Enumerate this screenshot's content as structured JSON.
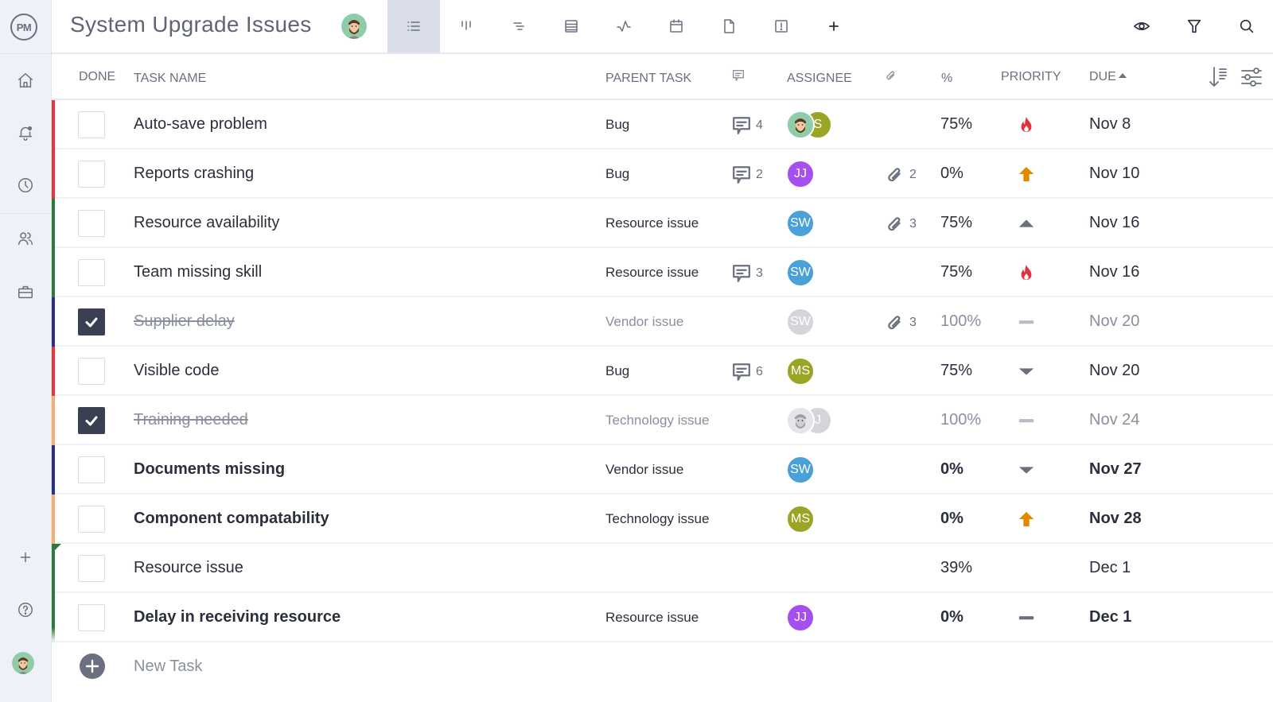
{
  "colors": {
    "red": "#e8343a",
    "green": "#2d7a3a",
    "navy": "#2b2f8f",
    "orange": "#f5b070",
    "jj": "#a64ff0",
    "sw": "#4aa0d9",
    "ms": "#9aa526",
    "grey_avatar": "#d3d5da",
    "priority_critical": "#e03340",
    "priority_high": "#e08a00",
    "priority_neutral": "#6b7080",
    "priority_done": "#b9bcc4"
  },
  "sidebar": {
    "logo": "PM",
    "items": [
      {
        "icon": "home-icon"
      },
      {
        "icon": "notifications-bell-icon"
      },
      {
        "icon": "clock-icon"
      },
      {
        "icon": "team-icon"
      },
      {
        "icon": "briefcase-icon"
      },
      {
        "icon": "plus-icon"
      },
      {
        "icon": "help-icon"
      },
      {
        "icon": "user-avatar"
      }
    ]
  },
  "header": {
    "title": "System Upgrade Issues",
    "view_tabs": [
      {
        "name": "list-view",
        "active": true
      },
      {
        "name": "board-view",
        "active": false
      },
      {
        "name": "gantt-view",
        "active": false
      },
      {
        "name": "sheet-view",
        "active": false
      },
      {
        "name": "dashboard-view",
        "active": false
      },
      {
        "name": "calendar-view",
        "active": false
      },
      {
        "name": "files-view",
        "active": false
      },
      {
        "name": "risks-view",
        "active": false
      },
      {
        "name": "add-view",
        "active": false
      }
    ],
    "actions": [
      "show-hide",
      "filter",
      "search"
    ]
  },
  "table": {
    "columns": {
      "done": "DONE",
      "task_name": "TASK NAME",
      "parent_task": "PARENT TASK",
      "comments": "comments-icon",
      "assignee": "ASSIGNEE",
      "attachments": "attachment-icon",
      "percent": "%",
      "priority": "PRIORITY",
      "due": "DUE"
    },
    "sort": {
      "column": "DUE",
      "direction": "ascending"
    },
    "rows": [
      {
        "name": "Auto-save problem",
        "parent": "Bug",
        "comments": "4",
        "attachments": "",
        "assignees": [
          {
            "type": "photo"
          },
          {
            "initials": "S",
            "color": "ms"
          }
        ],
        "percent": "75%",
        "priority": "critical",
        "due": "Nov 8",
        "done": false,
        "bold": false,
        "bar": "red"
      },
      {
        "name": "Reports crashing",
        "parent": "Bug",
        "comments": "2",
        "attachments": "2",
        "assignees": [
          {
            "initials": "JJ",
            "color": "jj"
          }
        ],
        "percent": "0%",
        "priority": "high",
        "due": "Nov 10",
        "done": false,
        "bold": false,
        "bar": "red"
      },
      {
        "name": "Resource availability",
        "parent": "Resource issue",
        "comments": "",
        "attachments": "3",
        "assignees": [
          {
            "initials": "SW",
            "color": "sw"
          }
        ],
        "percent": "75%",
        "priority": "medium",
        "due": "Nov 16",
        "done": false,
        "bold": false,
        "bar": "green"
      },
      {
        "name": "Team missing skill",
        "parent": "Resource issue",
        "comments": "3",
        "attachments": "",
        "assignees": [
          {
            "initials": "SW",
            "color": "sw"
          }
        ],
        "percent": "75%",
        "priority": "critical",
        "due": "Nov 16",
        "done": false,
        "bold": false,
        "bar": "green"
      },
      {
        "name": "Supplier delay",
        "parent": "Vendor issue",
        "comments": "",
        "attachments": "3",
        "assignees": [
          {
            "initials": "SW",
            "color": "grey_avatar"
          }
        ],
        "percent": "100%",
        "priority": "none",
        "due": "Nov 20",
        "done": true,
        "bold": false,
        "bar": "navy"
      },
      {
        "name": "Visible code",
        "parent": "Bug",
        "comments": "6",
        "attachments": "",
        "assignees": [
          {
            "initials": "MS",
            "color": "ms"
          }
        ],
        "percent": "75%",
        "priority": "low",
        "due": "Nov 20",
        "done": false,
        "bold": false,
        "bar": "red"
      },
      {
        "name": "Training needed",
        "parent": "Technology issue",
        "comments": "",
        "attachments": "",
        "assignees": [
          {
            "type": "photo-grey"
          },
          {
            "initials": "J",
            "color": "grey_avatar"
          }
        ],
        "percent": "100%",
        "priority": "none",
        "due": "Nov 24",
        "done": true,
        "bold": false,
        "bar": "orange"
      },
      {
        "name": "Documents missing",
        "parent": "Vendor issue",
        "comments": "",
        "attachments": "",
        "assignees": [
          {
            "initials": "SW",
            "color": "sw"
          }
        ],
        "percent": "0%",
        "priority": "low",
        "due": "Nov 27",
        "done": false,
        "bold": true,
        "bar": "navy"
      },
      {
        "name": "Component compatability",
        "parent": "Technology issue",
        "comments": "",
        "attachments": "",
        "assignees": [
          {
            "initials": "MS",
            "color": "ms"
          }
        ],
        "percent": "0%",
        "priority": "high",
        "due": "Nov 28",
        "done": false,
        "bold": true,
        "bar": "orange"
      },
      {
        "name": "Resource issue",
        "parent": "",
        "comments": "",
        "attachments": "",
        "assignees": [],
        "percent": "39%",
        "priority": "",
        "due": "Dec 1",
        "done": false,
        "bold": false,
        "bar": "green",
        "is_parent": true
      },
      {
        "name": "Delay in receiving resource",
        "parent": "Resource issue",
        "comments": "",
        "attachments": "",
        "assignees": [
          {
            "initials": "JJ",
            "color": "jj"
          }
        ],
        "percent": "0%",
        "priority": "none-active",
        "due": "Dec 1",
        "done": false,
        "bold": true,
        "bar": "green"
      }
    ],
    "new_task_label": "New Task"
  }
}
